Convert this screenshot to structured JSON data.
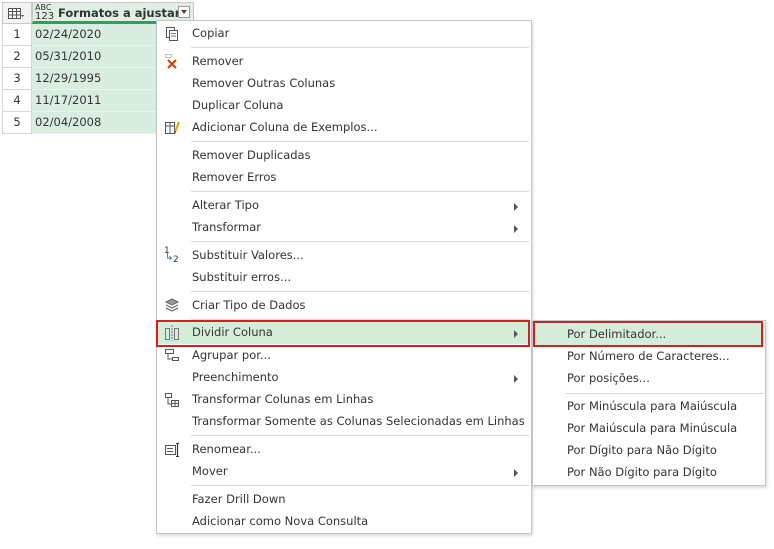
{
  "table": {
    "type_icon_top": "ABC",
    "type_icon_bottom": "123",
    "column_header": "Formatos a ajustar",
    "rows": [
      {
        "num": "1",
        "value": "02/24/2020"
      },
      {
        "num": "2",
        "value": "05/31/2010"
      },
      {
        "num": "3",
        "value": "12/29/1995"
      },
      {
        "num": "4",
        "value": "11/17/2011"
      },
      {
        "num": "5",
        "value": "02/04/2008"
      }
    ]
  },
  "context_menu": {
    "items": {
      "copy": "Copiar",
      "remove": "Remover",
      "remove_other": "Remover Outras Colunas",
      "duplicate": "Duplicar Coluna",
      "add_examples": "Adicionar Coluna de Exemplos...",
      "remove_duplicates": "Remover Duplicadas",
      "remove_errors": "Remover Erros",
      "change_type": "Alterar Tipo",
      "transform": "Transformar",
      "replace_values": "Substituir Valores...",
      "replace_errors": "Substituir erros...",
      "create_data_type": "Criar Tipo de Dados",
      "split_column": "Dividir Coluna",
      "group_by": "Agrupar por...",
      "fill": "Preenchimento",
      "unpivot": "Transformar Colunas em Linhas",
      "unpivot_selected": "Transformar Somente as Colunas Selecionadas em Linhas",
      "rename": "Renomear...",
      "move": "Mover",
      "drill_down": "Fazer Drill Down",
      "add_new_query": "Adicionar como Nova Consulta"
    },
    "replace_icon_top": "1",
    "replace_icon_bottom": "2"
  },
  "submenu": {
    "by_delimiter": "Por Delimitador...",
    "by_num_chars": "Por Número de Caracteres...",
    "by_positions": "Por posições...",
    "lower_to_upper": "Por Minúscula para Maiúscula",
    "upper_to_lower": "Por Maiúscula para Minúscula",
    "digit_to_nondigit": "Por Dígito para Não Dígito",
    "nondigit_to_digit": "Por Não Dígito para Dígito"
  },
  "colors": {
    "accent_green": "#27a35b",
    "highlight": "#d5eed9",
    "callout_red": "#d42020"
  }
}
